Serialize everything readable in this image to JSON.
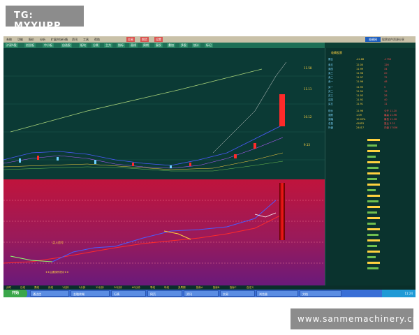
{
  "badge_top": "TG: MYYJJPP",
  "badge_bottom": "www.sanmemachinery.cn",
  "menubar": {
    "items": [
      "系统",
      "功能",
      "报价",
      "分析",
      "扩展市场行情",
      "资讯",
      "工具",
      "帮助"
    ],
    "buttons": [
      "交易",
      "期货",
      "设置"
    ],
    "brand_logo": "吸睛网",
    "brand_text": "股票软件资源分享"
  },
  "toolbar": {
    "buttons": [
      "沪深A股",
      "创业板",
      "中小板",
      "自选股",
      "板块",
      "分类",
      "主力",
      "指标",
      "画线",
      "周期",
      "复权",
      "叠加",
      "多股",
      "统计",
      "标记"
    ]
  },
  "right_panel": {
    "title": "吸睛股票",
    "rows": [
      {
        "label": "委比",
        "v1": "-42.86",
        "v2": "-1750"
      },
      {
        "label": "卖五",
        "v1": "12.00",
        "v2": "126"
      },
      {
        "label": "卖四",
        "v1": "11.99",
        "v2": "34"
      },
      {
        "label": "卖三",
        "v1": "11.98",
        "v2": "20"
      },
      {
        "label": "卖二",
        "v1": "11.97",
        "v2": "72"
      },
      {
        "label": "卖一",
        "v1": "11.96",
        "v2": "48"
      },
      {
        "label": "买一",
        "v1": "11.95",
        "v2": "5"
      },
      {
        "label": "买二",
        "v1": "11.94",
        "v2": "19"
      },
      {
        "label": "买三",
        "v1": "11.93",
        "v2": "28"
      },
      {
        "label": "买四",
        "v1": "11.92",
        "v2": "40"
      },
      {
        "label": "买五",
        "v1": "11.91",
        "v2": "11"
      },
      {
        "label": "现价",
        "v1": "11.96",
        "v2": "今开 11.20"
      },
      {
        "label": "涨跌",
        "v1": "1.09",
        "v2": "最高 11.96"
      },
      {
        "label": "涨幅",
        "v1": "10.03%",
        "v2": "最低 11.16"
      },
      {
        "label": "总量",
        "v1": "41853",
        "v2": "量比 3.21"
      },
      {
        "label": "外盘",
        "v1": "24417",
        "v2": "内盘 17436"
      }
    ]
  },
  "chart_labels": {
    "buy_tag": "买入信号",
    "note": "★★主要操作提示★★"
  },
  "bottom_tabs": [
    "分时",
    "日线",
    "周线",
    "月线",
    "1分钟",
    "5分钟",
    "15分钟",
    "30分钟",
    "60分钟",
    "季线",
    "年线",
    "多周期",
    "指标A",
    "指标B",
    "指标C",
    "自定义"
  ],
  "taskbar": {
    "start": "开始",
    "tasks": [
      "通达信",
      "金融终端",
      "行情",
      "网页",
      "资讯",
      "交易",
      "浏览器",
      "文档"
    ],
    "clock": "11:24"
  },
  "colors": {
    "screen_bg": "#0b3a35",
    "candle_red": "#ff2a2a",
    "line_green": "#6fbf4f",
    "line_blue": "#4a5bff",
    "panel_red": "#c0143c",
    "panel_magenta": "#9a1a7a"
  }
}
